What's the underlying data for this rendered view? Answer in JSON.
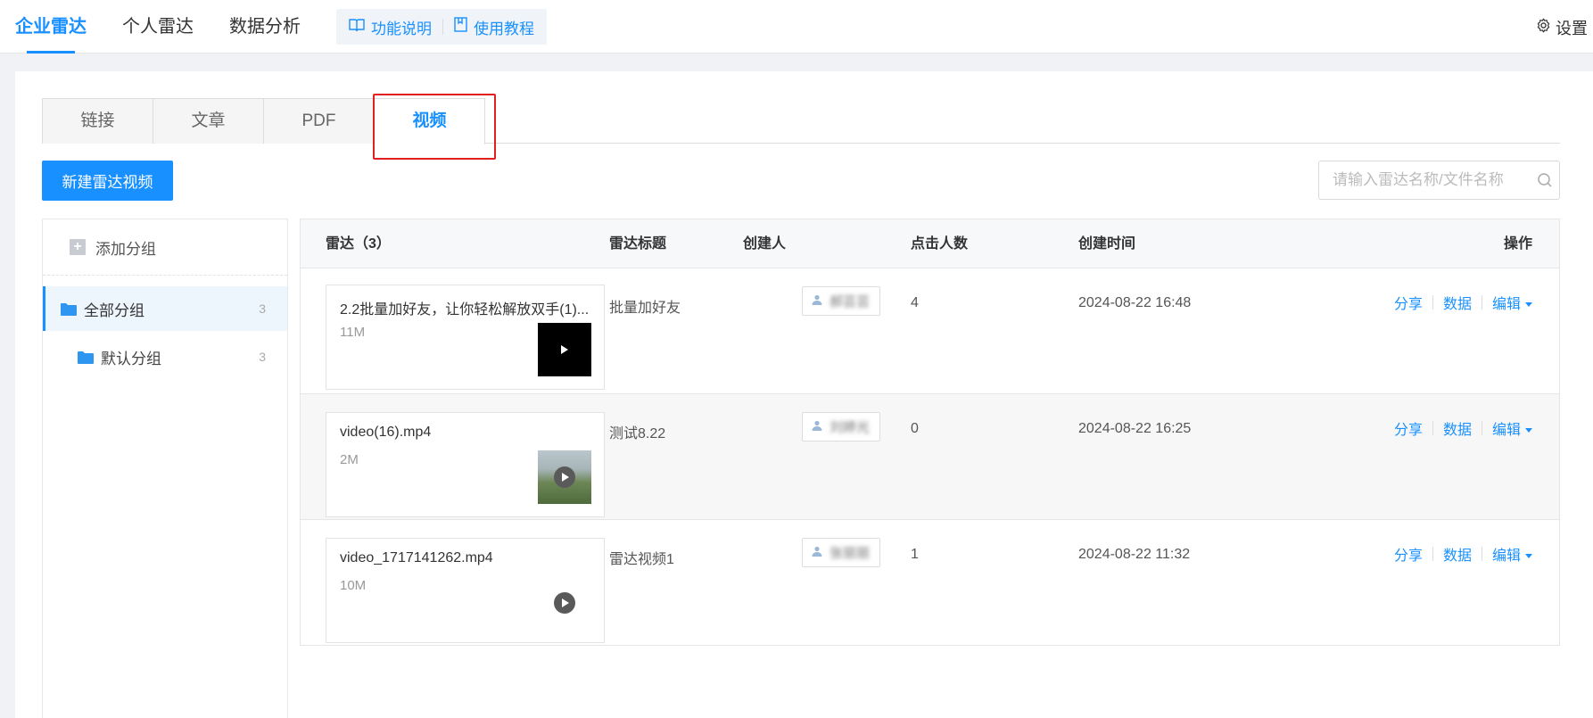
{
  "topnav": {
    "tabs": [
      {
        "label": "企业雷达",
        "active": true
      },
      {
        "label": "个人雷达",
        "active": false
      },
      {
        "label": "数据分析",
        "active": false
      }
    ],
    "help_links": [
      {
        "label": "功能说明",
        "icon": "book-icon"
      },
      {
        "label": "使用教程",
        "icon": "bookmark-icon"
      }
    ],
    "settings_label": "设置"
  },
  "content_tabs": [
    {
      "label": "链接",
      "active": false
    },
    {
      "label": "文章",
      "active": false
    },
    {
      "label": "PDF",
      "active": false
    },
    {
      "label": "视频",
      "active": true
    }
  ],
  "toolbar": {
    "new_button_label": "新建雷达视频",
    "search_placeholder": "请输入雷达名称/文件名称"
  },
  "groups": {
    "add_label": "添加分组",
    "items": [
      {
        "label": "全部分组",
        "count": "3",
        "selected": true
      },
      {
        "label": "默认分组",
        "count": "3",
        "selected": false
      }
    ]
  },
  "table": {
    "headers": {
      "radar": "雷达（3）",
      "title": "雷达标题",
      "creator": "创建人",
      "clicks": "点击人数",
      "created": "创建时间",
      "actions": "操作"
    },
    "rows": [
      {
        "file_name": "2.2批量加好友，让你轻松解放双手(1)...",
        "file_size": "11M",
        "thumb": "black",
        "title": "批量加好友",
        "creator": "郝芸芸",
        "clicks": "4",
        "created": "2024-08-22 16:48"
      },
      {
        "file_name": "video(16).mp4",
        "file_size": "2M",
        "thumb": "landscape",
        "title": "测试8.22",
        "creator": "刘婷光",
        "clicks": "0",
        "created": "2024-08-22 16:25"
      },
      {
        "file_name": "video_1717141262.mp4",
        "file_size": "10M",
        "thumb": "blank",
        "title": "雷达视频1",
        "creator": "张丽丽",
        "clicks": "1",
        "created": "2024-08-22 11:32"
      }
    ],
    "actions": {
      "share": "分享",
      "data": "数据",
      "edit": "编辑"
    }
  },
  "colors": {
    "accent": "#1890ff",
    "highlight": "#e02020"
  }
}
